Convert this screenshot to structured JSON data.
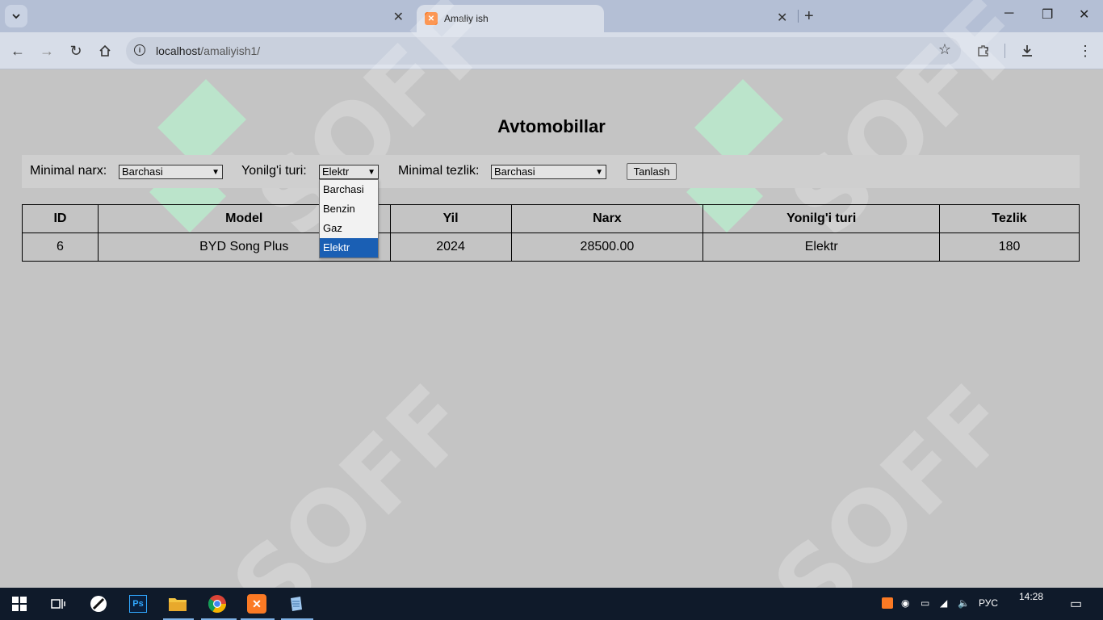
{
  "browser": {
    "active_tab_title": "Amaliy ish",
    "url_host": "localhost",
    "url_path": "/amaliyish1/"
  },
  "page": {
    "title": "Avtomobillar",
    "filters": {
      "min_price_label": "Minimal narx:",
      "min_price_value": "Barchasi",
      "fuel_label": "Yonilg'i turi:",
      "fuel_value": "Elektr",
      "min_speed_label": "Minimal tezlik:",
      "min_speed_value": "Barchasi",
      "submit_label": "Tanlash"
    },
    "fuel_options": [
      "Barchasi",
      "Benzin",
      "Gaz",
      "Elektr"
    ],
    "fuel_selected_index": 3,
    "table": {
      "headers": [
        "ID",
        "Model",
        "Yil",
        "Narx",
        "Yonilg'i turi",
        "Tezlik"
      ],
      "rows": [
        [
          "6",
          "BYD Song Plus",
          "2024",
          "28500.00",
          "Elektr",
          "180"
        ]
      ]
    },
    "watermark_text": "SOFF"
  },
  "taskbar": {
    "language": "РУС",
    "time": "14:28"
  },
  "colors": {
    "page_bg": "#c4c4c4",
    "selected_option": "#1a5fb4",
    "taskbar": "#0f1a2a"
  }
}
